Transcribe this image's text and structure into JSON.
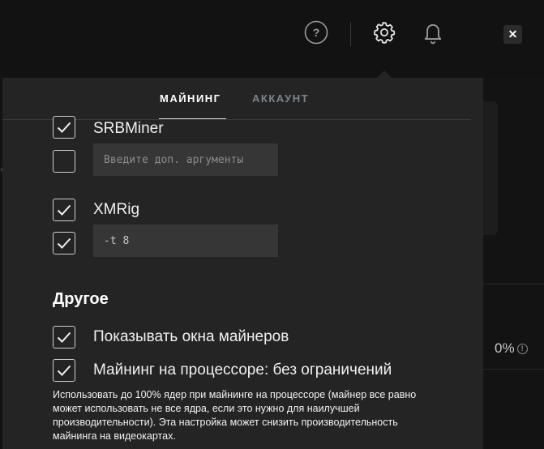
{
  "header": {
    "help_icon": "question-circle-icon",
    "settings_icon": "gear-icon",
    "notifications_icon": "bell-icon",
    "close_label": "✕"
  },
  "background": {
    "percent": "0%"
  },
  "tabs": [
    {
      "label": "МАЙНИНГ",
      "active": true
    },
    {
      "label": "АККАУНТ",
      "active": false
    }
  ],
  "miners": [
    {
      "name": "SRBMiner",
      "enabled": true,
      "args_enabled": false,
      "args_value": "",
      "args_placeholder": "Введите доп. аргументы"
    },
    {
      "name": "XMRig",
      "enabled": true,
      "args_enabled": true,
      "args_value": "-t 8",
      "args_placeholder": ""
    }
  ],
  "other": {
    "title": "Другое",
    "options": [
      {
        "label": "Показывать окна майнеров",
        "checked": true
      },
      {
        "label": "Майнинг на процессоре: без ограничений",
        "checked": true
      }
    ],
    "description": "Использовать до 100% ядер при майнинге на процессоре (майнер все равно может использовать не все ядра, если это нужно для наилучшей производительности). Эта настройка может снизить производительность майнинга на видеокартах."
  },
  "colors": {
    "background": "#131313",
    "popup": "#242424",
    "input": "#363636",
    "inactive_tab": "#7a8590"
  }
}
